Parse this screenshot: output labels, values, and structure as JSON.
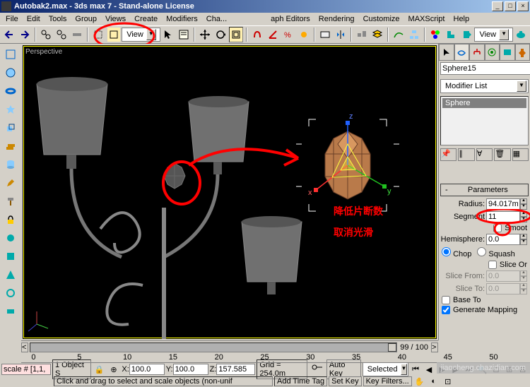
{
  "title": "Autobak2.max - 3ds max 7 - Stand-alone License",
  "menu": [
    "File",
    "Edit",
    "Tools",
    "Group",
    "Views",
    "Create",
    "Modifiers",
    "Cha...",
    "aph Editors",
    "Rendering",
    "Customize",
    "MAXScript",
    "Help"
  ],
  "view_label1": "View",
  "view_label2": "View",
  "viewport_label": "Perspective",
  "object_name": "Sphere15",
  "modifier_list": "Modifier List",
  "stack_item": "Sphere",
  "rollout_title": "Parameters",
  "params": {
    "radius_label": "Radius:",
    "radius_value": "94.017m",
    "segments_label": "Segment",
    "segments_value": "11",
    "smooth_label": "Smoot",
    "hemisphere_label": "Hemisphere:",
    "hemisphere_value": "0.0",
    "chop_label": "Chop",
    "squash_label": "Squash",
    "sliceon_label": "Slice Or",
    "slicefrom_label": "Slice From:",
    "slicefrom_value": "0.0",
    "sliceto_label": "Slice To:",
    "sliceto_value": "0.0",
    "baseto_label": "Base To",
    "genmap_label": "Generate Mapping"
  },
  "timeline": {
    "frame_display": "99 / 100",
    "ticks": [
      "0",
      "5",
      "10",
      "15",
      "20",
      "25",
      "30",
      "35",
      "40",
      "45",
      "50"
    ]
  },
  "status": {
    "scale_label": "scale # [1,1,",
    "objects": "1 Object S",
    "x_label": "X:",
    "x_value": "100.0",
    "y_label": "Y:",
    "y_value": "100.0",
    "z_label": "Z:",
    "z_value": "157.585",
    "grid": "Grid = 254.0m",
    "autokey": "Auto Key",
    "selected": "Selected",
    "setkey": "Set Key",
    "keyfilters": "Key Filters..."
  },
  "prompt": {
    "line1": "Click and drag to select and scale objects  (non-unif",
    "line2": "Add Time Tag"
  },
  "annotations": {
    "reduce_segments": "降低片断数",
    "cancel_smooth": "取消光滑"
  }
}
